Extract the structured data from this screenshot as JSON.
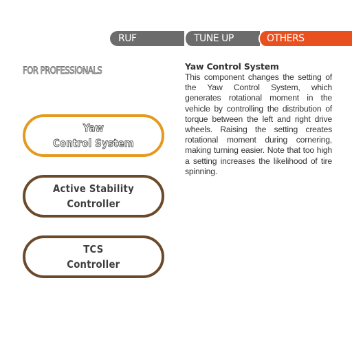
{
  "tabs": {
    "ruf": "RUF",
    "tune_up": "TUNE UP",
    "others": "OTHERS"
  },
  "colors": {
    "tab_inactive": "#6c6c6c",
    "tab_active": "#e8501f",
    "button_border": "#6b4a2c",
    "button_selected_border": "#e49a1e"
  },
  "section_heading": "FOR PROFESSIONALS",
  "menu": {
    "yaw_line1": "Yaw",
    "yaw_line2": "Control System",
    "asc_line1": "Active Stability",
    "asc_line2": "Controller",
    "tcs_line1": "TCS",
    "tcs_line2": "Controller",
    "selected": "Yaw Control System"
  },
  "description": {
    "title": "Yaw Control System",
    "body": "This component changes the setting of the Yaw Control System, which generates rotational moment in the vehicle by controlling the distribution of torque between the left and right drive wheels. Raising the setting creates rotational moment during cornering, making turning easier. Note that too high a setting increases the likelihood of tire spinning."
  }
}
